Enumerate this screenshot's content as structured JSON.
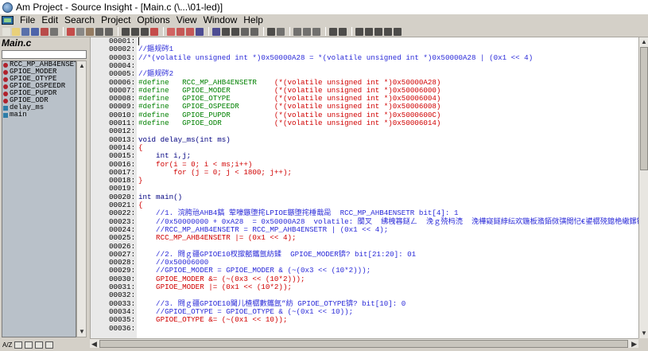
{
  "window": {
    "title": "Am Project - Source Insight - [Main.c (\\...\\01-led)]"
  },
  "menu": {
    "items": [
      "File",
      "Edit",
      "Search",
      "Project",
      "Options",
      "View",
      "Window",
      "Help"
    ]
  },
  "toolbar": {
    "buttons": [
      "new-file-icon",
      "open-file-icon",
      "save-icon",
      "save-all-icon",
      "close-icon",
      "print-icon",
      "cut-icon",
      "copy-icon",
      "paste-icon",
      "undo-icon",
      "redo-icon",
      "search-icon",
      "search-project-icon",
      "lookup-icon",
      "jump-icon",
      "back-icon",
      "bookmark-icon",
      "bookmark-toggle-icon",
      "nav-back-icon",
      "nav-forward-icon",
      "go-to-line-icon",
      "go-to-symbol-icon",
      "symbol-window-icon",
      "context-window-icon",
      "relation-icon",
      "layout1-icon",
      "layout2-icon",
      "layout3-icon",
      "layout4-icon",
      "sync-icon",
      "help-icon",
      "toggle-browse-icon",
      "toggle-symbols-icon",
      "toggle-relation-icon",
      "toggle-context-icon",
      "project-window-icon"
    ]
  },
  "left_panel": {
    "title": "Main.c",
    "symbols": [
      {
        "name": "RCC_MP_AHB4ENSETR",
        "kind": "define"
      },
      {
        "name": "GPIOE_MODER",
        "kind": "define"
      },
      {
        "name": "GPIOE_OTYPE",
        "kind": "define"
      },
      {
        "name": "GPIOE_OSPEEDR",
        "kind": "define"
      },
      {
        "name": "GPIOE_PUPDR",
        "kind": "define"
      },
      {
        "name": "GPIOE_ODR",
        "kind": "define"
      },
      {
        "name": "delay_ms",
        "kind": "func"
      },
      {
        "name": "main",
        "kind": "func"
      }
    ]
  },
  "status": {
    "mode": "A/Z"
  },
  "editor": {
    "lines": [
      {
        "n": "00001:",
        "segs": []
      },
      {
        "n": "00002:",
        "segs": [
          {
            "t": "//鏂规硶1",
            "c": "comment"
          }
        ]
      },
      {
        "n": "00003:",
        "segs": [
          {
            "t": "//*(volatile unsigned int *)0x50000A28 = *(volatile unsigned int *)0x50000A28 | (0x1 << 4)",
            "c": "comment"
          }
        ]
      },
      {
        "n": "00004:",
        "segs": []
      },
      {
        "n": "00005:",
        "segs": [
          {
            "t": "//鏂规硶2",
            "c": "comment"
          }
        ]
      },
      {
        "n": "00006:",
        "segs": [
          {
            "t": "#define   RCC_MP_AHB4ENSETR    ",
            "c": "define"
          },
          {
            "t": "(*(volatile unsigned int *)0x50000A28)",
            "c": "red"
          }
        ]
      },
      {
        "n": "00007:",
        "segs": [
          {
            "t": "#define   GPIOE_MODER          ",
            "c": "define"
          },
          {
            "t": "(*(volatile unsigned int *)0x50006000)",
            "c": "red"
          }
        ]
      },
      {
        "n": "00008:",
        "segs": [
          {
            "t": "#define   GPIOE_OTYPE          ",
            "c": "define"
          },
          {
            "t": "(*(volatile unsigned int *)0x50006004)",
            "c": "red"
          }
        ]
      },
      {
        "n": "00009:",
        "segs": [
          {
            "t": "#define   GPIOE_OSPEEDR        ",
            "c": "define"
          },
          {
            "t": "(*(volatile unsigned int *)0x50006008)",
            "c": "red"
          }
        ]
      },
      {
        "n": "00010:",
        "segs": [
          {
            "t": "#define   GPIOE_PUPDR          ",
            "c": "define"
          },
          {
            "t": "(*(volatile unsigned int *)0x5000600C)",
            "c": "red"
          }
        ]
      },
      {
        "n": "00011:",
        "segs": [
          {
            "t": "#define   GPIOE_ODR            ",
            "c": "define"
          },
          {
            "t": "(*(volatile unsigned int *)0x50006014)",
            "c": "red"
          }
        ]
      },
      {
        "n": "00012:",
        "segs": []
      },
      {
        "n": "00013:",
        "segs": [
          {
            "t": "void delay_ms(int ms)",
            "c": "kw"
          }
        ]
      },
      {
        "n": "00014:",
        "segs": [
          {
            "t": "{",
            "c": "red"
          }
        ]
      },
      {
        "n": "00015:",
        "segs": [
          {
            "t": "    int i,j;",
            "c": "kw"
          }
        ]
      },
      {
        "n": "00016:",
        "segs": [
          {
            "t": "    for(i = 0; i < ms;i++)",
            "c": "red"
          }
        ]
      },
      {
        "n": "00017:",
        "segs": [
          {
            "t": "        for (j = 0; j < 1800; j++);",
            "c": "red"
          }
        ]
      },
      {
        "n": "00018:",
        "segs": [
          {
            "t": "}",
            "c": "red"
          }
        ]
      },
      {
        "n": "00019:",
        "segs": []
      },
      {
        "n": "00020:",
        "segs": [
          {
            "t": "int main()",
            "c": "kw"
          }
        ]
      },
      {
        "n": "00021:",
        "segs": [
          {
            "t": "{",
            "c": "red"
          }
        ]
      },
      {
        "n": "00022:",
        "segs": [
          {
            "t": "    //1. 浣胯兘AHB4鎬 荤嚎鏃堕挓LPIOE鏃堕挓棰戠巼  RCC_MP_AHB4ENSETR bit[4]: 1",
            "c": "comment"
          }
        ]
      },
      {
        "n": "00023:",
        "segs": [
          {
            "t": "    //0x50000000 + 0xA28  = 0x50000A28  volatile: 闃叉  绋栧簭鎹ㄥ  浼ｇ殑杩涜  浼樺寲鐩綍纭欢鍦板潃銆傚彉閲忋€鍙樼殑鎴栬繖鏍锋病",
            "c": "comment"
          }
        ]
      },
      {
        "n": "00024:",
        "segs": [
          {
            "t": "    //RCC_MP_AHB4ENSETR = RCC_MP_AHB4ENSETR | (0x1 << 4);",
            "c": "comment"
          }
        ]
      },
      {
        "n": "00025:",
        "segs": [
          {
            "t": "    RCC_MP_AHB4ENSETR |= (0x1 << 4);",
            "c": "red"
          }
        ]
      },
      {
        "n": "00026:",
        "segs": []
      },
      {
        "n": "00027:",
        "segs": [
          {
            "t": "    //2. 閰ｇ疆GPIOE10杈撳嚭鑴氬紡鍒  GPIOE_MODER锛? bit[21:20]: 01",
            "c": "comment"
          }
        ]
      },
      {
        "n": "00028:",
        "segs": [
          {
            "t": "    //0x50006000",
            "c": "comment"
          }
        ]
      },
      {
        "n": "00029:",
        "segs": [
          {
            "t": "    //GPIOE_MODER = GPIOE_MODER & (~(0x3 << (10*2)));",
            "c": "comment"
          }
        ]
      },
      {
        "n": "00030:",
        "segs": [
          {
            "t": "    GPIOE_MODER &= (~(0x3 << (10*2)));",
            "c": "red"
          }
        ]
      },
      {
        "n": "00031:",
        "segs": [
          {
            "t": "    GPIOE_MODER |= (0x1 << (10*2));",
            "c": "red"
          }
        ]
      },
      {
        "n": "00032:",
        "segs": []
      },
      {
        "n": "00033:",
        "segs": [
          {
            "t": "    //3. 閰ｇ疆GPIOE10閫儿楂樼數鑴氬”紡 GPIOE_OTYPE锛? bit[10]: 0",
            "c": "comment"
          }
        ]
      },
      {
        "n": "00034:",
        "segs": [
          {
            "t": "    //GPIOE_OTYPE = GPIOE_OTYPE & (~(0x1 << 10));",
            "c": "comment"
          }
        ]
      },
      {
        "n": "00035:",
        "segs": [
          {
            "t": "    GPIOE_OTYPE &= (~(0x1 << 10));",
            "c": "red"
          }
        ]
      },
      {
        "n": "00036:",
        "segs": []
      }
    ]
  }
}
